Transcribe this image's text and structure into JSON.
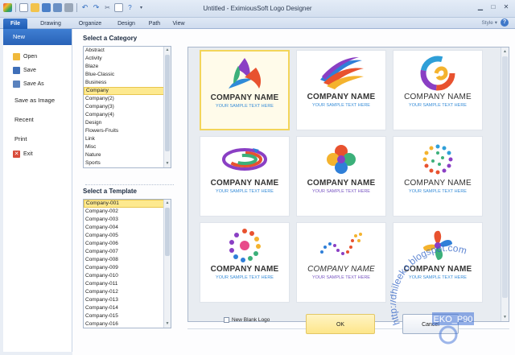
{
  "window": {
    "title": "Untitled - EximiousSoft Logo Designer"
  },
  "ribbon": {
    "tabs": [
      "File",
      "Drawing",
      "Organize",
      "Design",
      "Path",
      "View"
    ],
    "style_label": "Style",
    "help": "?"
  },
  "sidebar": {
    "new_label": "New",
    "items": [
      {
        "label": "Open",
        "icon": "folder-icon"
      },
      {
        "label": "Save",
        "icon": "save-icon"
      },
      {
        "label": "Save As",
        "icon": "save-as-icon"
      }
    ],
    "save_as_image": "Save as Image",
    "recent": "Recent",
    "print": "Print",
    "exit": "Exit"
  },
  "category": {
    "heading": "Select a Category",
    "selected": "Company",
    "items": [
      "Abstract",
      "Activity",
      "Blaze",
      "Blue-Classic",
      "Business",
      "Company",
      "Company(2)",
      "Company(3)",
      "Company(4)",
      "Design",
      "Flowers-Fruits",
      "Link",
      "Misc",
      "Nature",
      "Sports"
    ]
  },
  "template": {
    "heading": "Select a Template",
    "selected": "Company-001",
    "items": [
      "Company-001",
      "Company-002",
      "Company-003",
      "Company-004",
      "Company-005",
      "Company-006",
      "Company-007",
      "Company-008",
      "Company-009",
      "Company-010",
      "Company-011",
      "Company-012",
      "Company-013",
      "Company-014",
      "Company-015",
      "Company-016"
    ]
  },
  "gallery": {
    "cards": [
      {
        "name": "COMPANY NAME",
        "sub": "YOUR SAMPLE TEXT HERE",
        "selected": true
      },
      {
        "name": "COMPANY NAME",
        "sub": "YOUR SAMPLE TEXT HERE"
      },
      {
        "name": "COMPANY NAME",
        "sub": "YOUR SAMPLE TEXT HERE"
      },
      {
        "name": "COMPANY NAME",
        "sub": "YOUR SAMPLE TEXT HERE"
      },
      {
        "name": "COMPANY NAME",
        "sub": "YOUR SAMPLE TEXT HERE"
      },
      {
        "name": "COMPANY NAME",
        "sub": "YOUR SAMPLE TEXT HERE"
      },
      {
        "name": "COMPANY NAME",
        "sub": "YOUR SAMPLE TEXT HERE"
      },
      {
        "name": "COMPANY NAME",
        "sub": "YOUR SAMPLE TEXT HERE"
      },
      {
        "name": "COMPANY NAME",
        "sub": "YOUR SAMPLE TEXT HERE"
      }
    ]
  },
  "footer": {
    "blank_logo_label": "New Blank Logo",
    "ok_label": "OK",
    "cancel_label": "Cancel"
  },
  "watermark": {
    "url": "http://dhileeko.blogspot.com",
    "tag": "EKO_P90"
  }
}
